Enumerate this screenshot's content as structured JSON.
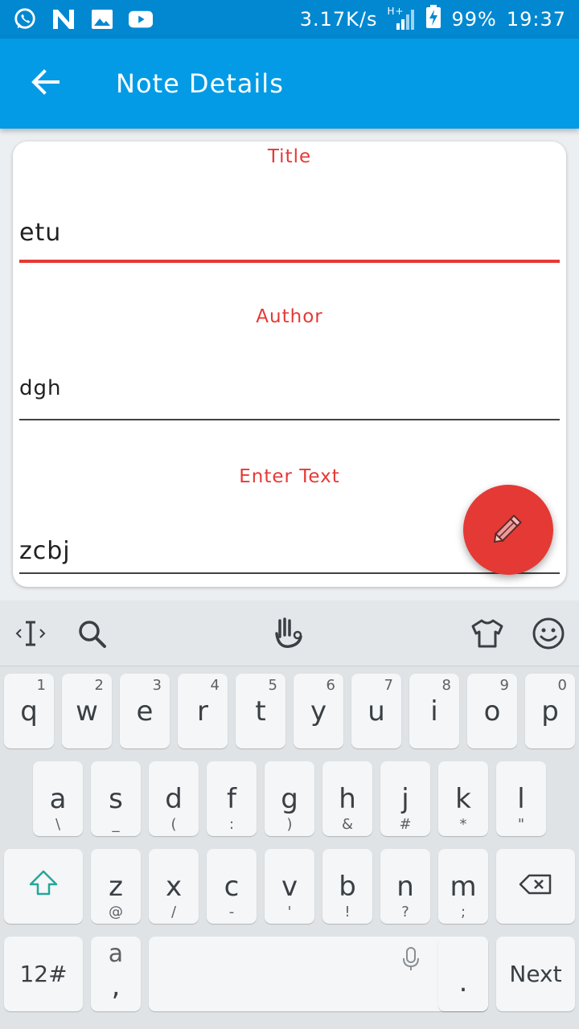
{
  "status_bar": {
    "net_speed": "3.17K/s",
    "network_type": "H+",
    "battery": "99%",
    "time": "19:37",
    "icons": [
      "whatsapp-icon",
      "n-icon",
      "image-icon",
      "youtube-icon"
    ]
  },
  "app_bar": {
    "title": "Note Details"
  },
  "form": {
    "title_label": "Title",
    "title_value": "etu",
    "author_label": "Author",
    "author_value": "dgh",
    "text_label": "Enter Text",
    "text_value": "zcbj"
  },
  "colors": {
    "status_bar": "#0288d1",
    "app_bar": "#039be5",
    "accent": "#e53935"
  },
  "keyboard": {
    "row1": [
      {
        "main": "q",
        "sub": "1"
      },
      {
        "main": "w",
        "sub": "2"
      },
      {
        "main": "e",
        "sub": "3"
      },
      {
        "main": "r",
        "sub": "4"
      },
      {
        "main": "t",
        "sub": "5"
      },
      {
        "main": "y",
        "sub": "6"
      },
      {
        "main": "u",
        "sub": "7"
      },
      {
        "main": "i",
        "sub": "8"
      },
      {
        "main": "o",
        "sub": "9"
      },
      {
        "main": "p",
        "sub": "0"
      }
    ],
    "row2": [
      {
        "main": "a",
        "sub": "\\"
      },
      {
        "main": "s",
        "sub": "_"
      },
      {
        "main": "d",
        "sub": "("
      },
      {
        "main": "f",
        "sub": ":"
      },
      {
        "main": "g",
        "sub": ")"
      },
      {
        "main": "h",
        "sub": "&"
      },
      {
        "main": "j",
        "sub": "#"
      },
      {
        "main": "k",
        "sub": "*"
      },
      {
        "main": "l",
        "sub": "\""
      }
    ],
    "row3": [
      {
        "main": "z",
        "sub": "@"
      },
      {
        "main": "x",
        "sub": "/"
      },
      {
        "main": "c",
        "sub": "-"
      },
      {
        "main": "v",
        "sub": "'"
      },
      {
        "main": "b",
        "sub": "!"
      },
      {
        "main": "n",
        "sub": "?"
      },
      {
        "main": "m",
        "sub": ";"
      }
    ],
    "symbols_label": "12#",
    "comma_top": "a",
    "comma_label": ",",
    "period_label": ".",
    "next_label": "Next"
  }
}
